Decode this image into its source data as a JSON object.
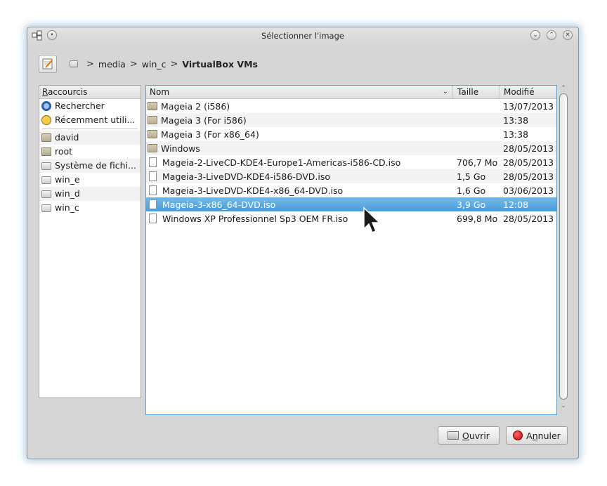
{
  "window": {
    "title": "Sélectionner l'image"
  },
  "pathbar": {
    "crumbs": [
      "media",
      "win_c",
      "VirtualBox VMs"
    ]
  },
  "places": {
    "header": "Raccourcis",
    "items": [
      {
        "label": "Rechercher",
        "icon": "search-icon"
      },
      {
        "label": "Récemment utili...",
        "icon": "clock-icon"
      },
      {
        "label": "david",
        "icon": "folder-icon"
      },
      {
        "label": "root",
        "icon": "home-folder-icon"
      },
      {
        "label": "Système de fichi...",
        "icon": "drive-icon"
      },
      {
        "label": "win_e",
        "icon": "drive-icon"
      },
      {
        "label": "win_d",
        "icon": "drive-icon"
      },
      {
        "label": "win_c",
        "icon": "drive-icon"
      }
    ]
  },
  "files": {
    "columns": {
      "name": "Nom",
      "size": "Taille",
      "modified": "Modifié"
    },
    "rows": [
      {
        "name": "Mageia 2 (i586)",
        "size": "",
        "modified": "13/07/2013",
        "type": "folder"
      },
      {
        "name": "Mageia 3 (For i586)",
        "size": "",
        "modified": "13:38",
        "type": "folder"
      },
      {
        "name": "Mageia 3 (For x86_64)",
        "size": "",
        "modified": "13:38",
        "type": "folder"
      },
      {
        "name": "Windows",
        "size": "",
        "modified": "28/05/2013",
        "type": "folder"
      },
      {
        "name": "Mageia-2-LiveCD-KDE4-Europe1-Americas-i586-CD.iso",
        "size": "706,7 Mo",
        "modified": "28/05/2013",
        "type": "file"
      },
      {
        "name": "Mageia-3-LiveDVD-KDE4-i586-DVD.iso",
        "size": "1,5 Go",
        "modified": "28/05/2013",
        "type": "file"
      },
      {
        "name": "Mageia-3-LiveDVD-KDE4-x86_64-DVD.iso",
        "size": "1,6 Go",
        "modified": "03/06/2013",
        "type": "file"
      },
      {
        "name": "Mageia-3-x86_64-DVD.iso",
        "size": "3,9 Go",
        "modified": "12:08",
        "type": "file",
        "selected": true
      },
      {
        "name": "Windows XP Professionnel Sp3 OEM FR.iso",
        "size": "699,8 Mo",
        "modified": "28/05/2013",
        "type": "file"
      }
    ]
  },
  "buttons": {
    "open_accel": "O",
    "open_rest": "uvrir",
    "cancel_pre": "A",
    "cancel_accel": "n",
    "cancel_rest": "nuler"
  },
  "colors": {
    "selection": "#4a9ddb",
    "focus_border": "#59a4d8"
  }
}
